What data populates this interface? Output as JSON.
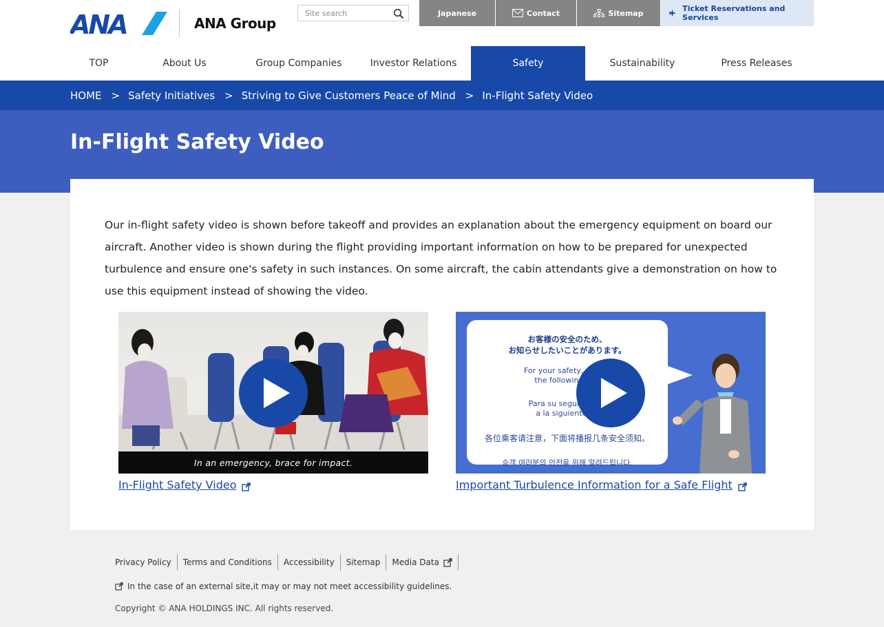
{
  "brand": {
    "logo_text": "ANA",
    "group_label": "ANA Group",
    "accent_color": "#1849a9"
  },
  "search": {
    "placeholder": "Site search",
    "icon": "search-icon"
  },
  "utility_nav": {
    "japanese": "Japanese",
    "contact": "Contact",
    "sitemap": "Sitemap",
    "ticket": "Ticket Reservations and Services"
  },
  "global_nav": {
    "items": [
      "TOP",
      "About Us",
      "Group Companies",
      "Investor Relations",
      "Safety",
      "Sustainability",
      "Press Releases"
    ],
    "active": "Safety"
  },
  "breadcrumb": {
    "home": "HOME",
    "level1": "Safety Initiatives",
    "level2": "Striving to Give Customers Peace of Mind",
    "current": "In-Flight Safety Video",
    "separator": ">"
  },
  "page": {
    "title": "In-Flight Safety Video",
    "intro": "Our in-flight safety video is shown before takeoff and provides an explanation about the emergency equipment on board our aircraft. Another video is shown during the flight providing important information on how to be prepared for unexpected turbulence and ensure one's safety in such instances. On some aircraft, the cabin attendants give a demonstration on how to use this equipment instead of showing the video."
  },
  "videos": [
    {
      "link_text": "In-Flight Safety Video",
      "caption": "In an emergency, brace for impact."
    },
    {
      "link_text": "Important Turbulence Information for a Safe Flight",
      "bubble_jp_1": "お客様の安全のため、",
      "bubble_jp_2": "お知らせしたいことがあります。",
      "bubble_en_1": "For your safety, please",
      "bubble_en_2": "the following info",
      "bubble_es_1": "Para su seguridad, p",
      "bubble_es_2": "a la siguiente inf",
      "bubble_zh": "各位乘客请注意，下面将播报几条安全须知。",
      "bubble_ko": "승객 여러분의 안전을 위해 알려드립니다."
    }
  ],
  "footer": {
    "links": [
      "Privacy Policy",
      "Terms and Conditions",
      "Accessibility",
      "Sitemap",
      "Media Data"
    ],
    "external_note": "In the case of an external site,it may or may not meet accessibility guidelines.",
    "copyright": "Copyright © ANA HOLDINGS INC. All rights reserved."
  }
}
